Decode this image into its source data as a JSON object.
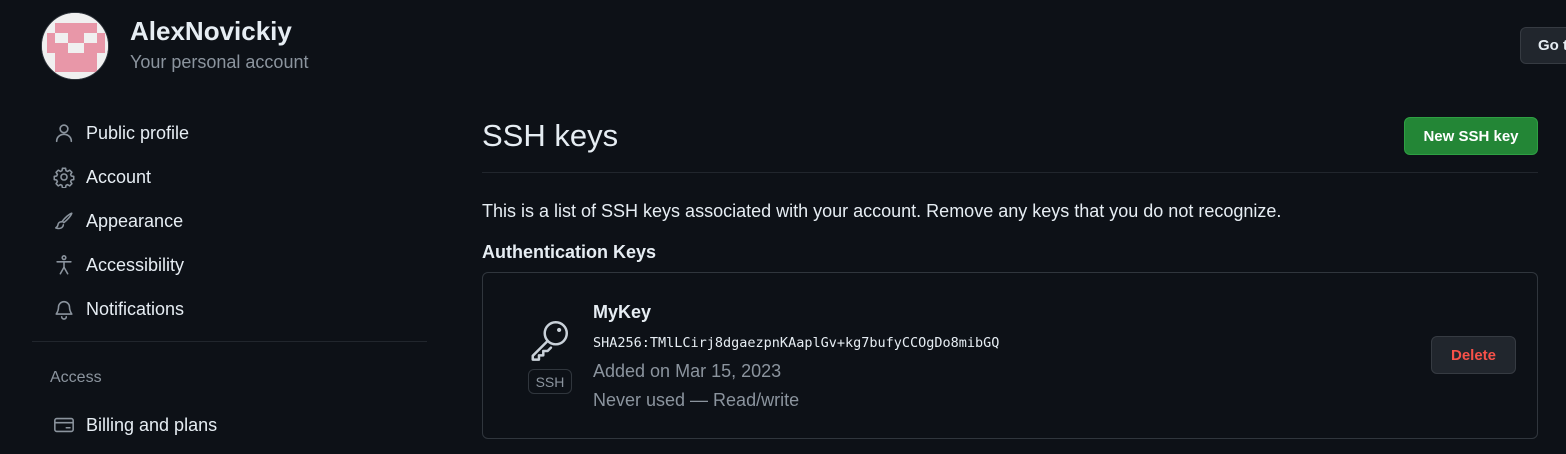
{
  "header": {
    "account_name": "AlexNovickiy",
    "account_subtitle": "Your personal account",
    "goto_button_label": "Go t"
  },
  "sidebar": {
    "items": [
      {
        "label": "Public profile",
        "icon": "person-icon"
      },
      {
        "label": "Account",
        "icon": "gear-icon"
      },
      {
        "label": "Appearance",
        "icon": "paintbrush-icon"
      },
      {
        "label": "Accessibility",
        "icon": "accessibility-icon"
      },
      {
        "label": "Notifications",
        "icon": "bell-icon"
      }
    ],
    "access_heading": "Access",
    "access_items": [
      {
        "label": "Billing and plans",
        "icon": "credit-card-icon"
      }
    ]
  },
  "main": {
    "title": "SSH keys",
    "new_key_button": "New SSH key",
    "intro": "This is a list of SSH keys associated with your account. Remove any keys that you do not recognize.",
    "section_heading": "Authentication Keys",
    "keys": [
      {
        "name": "MyKey",
        "fingerprint": "SHA256:TMlLCirj8dgaezpnKAaplGv+kg7bufyCCOgDo8mibGQ",
        "added": "Added on Mar 15, 2023",
        "usage": "Never used — Read/write",
        "type_badge": "SSH",
        "delete_label": "Delete"
      }
    ]
  },
  "colors": {
    "background": "#0d1117",
    "primary_button": "#238636",
    "danger_text": "#f85149",
    "muted_text": "#8b949e",
    "avatar_pink": "#e897a8"
  }
}
